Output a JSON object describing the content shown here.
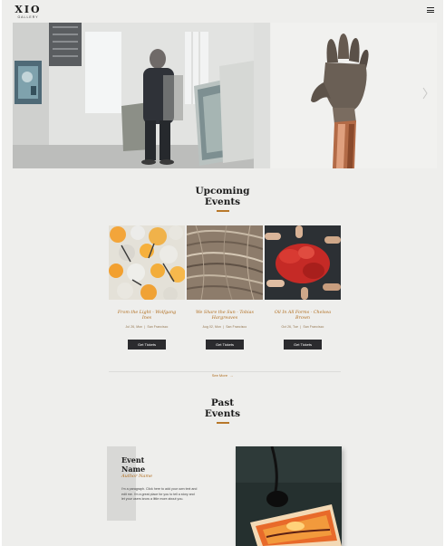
{
  "brand": {
    "name": "XIO",
    "sub": "GALLERY"
  },
  "nav": {
    "menu_icon": "hamburger-icon"
  },
  "upcoming": {
    "title_line1": "Upcoming",
    "title_line2": "Events",
    "events": [
      {
        "name_line1": "From the Light - Wolfgang",
        "name_line2": "Ines",
        "date": "Jul 26, Mon",
        "location": "San Francisco",
        "button": "Get Tickets"
      },
      {
        "name_line1": "We Share the Sun - Tobias",
        "name_line2": "Hargreaves",
        "date": "Aug 02, Mon",
        "location": "San Francisco",
        "button": "Get Tickets"
      },
      {
        "name_line1": "Oil In All Forms - Chelsea",
        "name_line2": "Brown",
        "date": "Oct 26, Tue",
        "location": "San Francisco",
        "button": "Get Tickets"
      }
    ],
    "see_more": "See More",
    "see_more_icon": "arrow-right-icon"
  },
  "past": {
    "title_line1": "Past",
    "title_line2": "Events",
    "event_name_line1": "Event",
    "event_name_line2": "Name",
    "author": "Author Name",
    "paragraph": "I'm a paragraph. Click here to add your own text and edit me. I'm a great place for you to tell a story and let your users know a little more about you."
  },
  "colors": {
    "accent": "#b06d1e",
    "button": "#2b2b2e",
    "background": "#eeeeec"
  }
}
